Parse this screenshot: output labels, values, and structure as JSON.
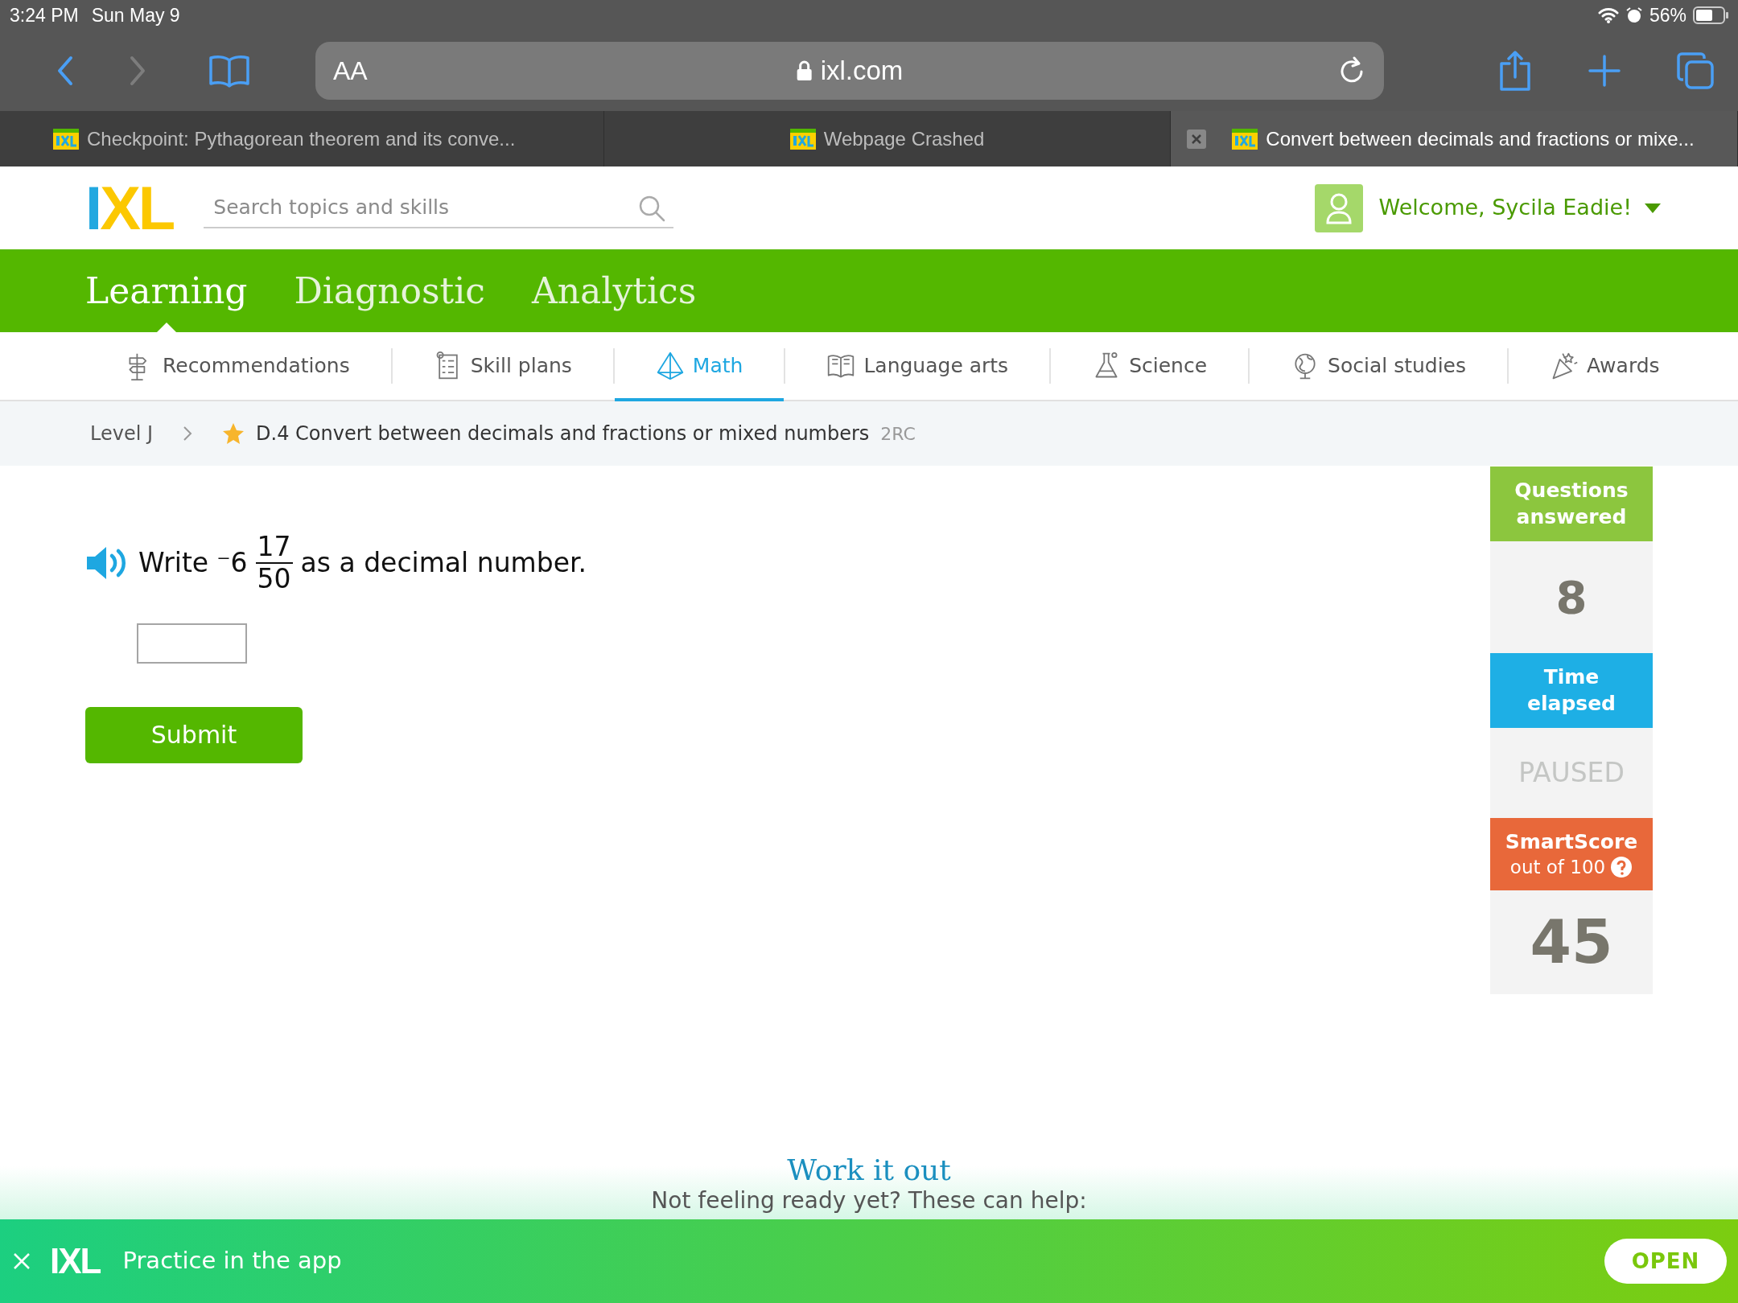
{
  "status_bar": {
    "time": "3:24 PM",
    "date": "Sun May 9",
    "battery": "56%"
  },
  "toolbar": {
    "nav": [
      {
        "kind": "back",
        "disabled": false
      },
      {
        "kind": "forward",
        "disabled": true
      }
    ],
    "text_size": "AA",
    "url": "ixl.com"
  },
  "browser_tabs": [
    {
      "title": "Checkpoint: Pythagorean theorem and its conve...",
      "selected": false
    },
    {
      "title": "Webpage Crashed",
      "selected": false
    },
    {
      "title": "Convert between decimals and fractions or mixe...",
      "selected": true
    }
  ],
  "header": {
    "logo": "IXL",
    "search": {
      "placeholder": "Search topics and skills"
    },
    "welcome": "Welcome, Sycila Eadie!"
  },
  "main_nav": [
    {
      "label": "Learning",
      "selected": true
    },
    {
      "label": "Diagnostic",
      "selected": false
    },
    {
      "label": "Analytics",
      "selected": false
    }
  ],
  "subjects": [
    {
      "kind": "recommendations",
      "label": "Recommendations",
      "selected": false
    },
    {
      "kind": "plans",
      "label": "Skill plans",
      "selected": false
    },
    {
      "kind": "math",
      "label": "Math",
      "selected": true
    },
    {
      "kind": "language",
      "label": "Language arts",
      "selected": false
    },
    {
      "kind": "science",
      "label": "Science",
      "selected": false
    },
    {
      "kind": "social",
      "label": "Social studies",
      "selected": false
    },
    {
      "kind": "awards",
      "label": "Awards",
      "selected": false
    }
  ],
  "breadcrumb": {
    "level": "Level J",
    "skill": "D.4 Convert between decimals and fractions or mixed numbers",
    "code": "2RC"
  },
  "question": {
    "before": "Write",
    "whole": "⁻6",
    "numerator": "17",
    "denominator": "50",
    "after": "as a decimal number.",
    "submit": "Submit"
  },
  "stats": [
    {
      "kind": "count",
      "label": "Questions answered",
      "value": "8"
    },
    {
      "kind": "time",
      "label": "Time elapsed",
      "value": "PAUSED"
    },
    {
      "kind": "score",
      "label": "SmartScore",
      "sublabel": "out of 100",
      "value": "45"
    }
  ],
  "work_it_out": {
    "title": "Work it out",
    "subtitle": "Not feeling ready yet? These can help:"
  },
  "app_banner": {
    "logo": "IXL",
    "text": "Practice in the app",
    "button": "OPEN"
  }
}
